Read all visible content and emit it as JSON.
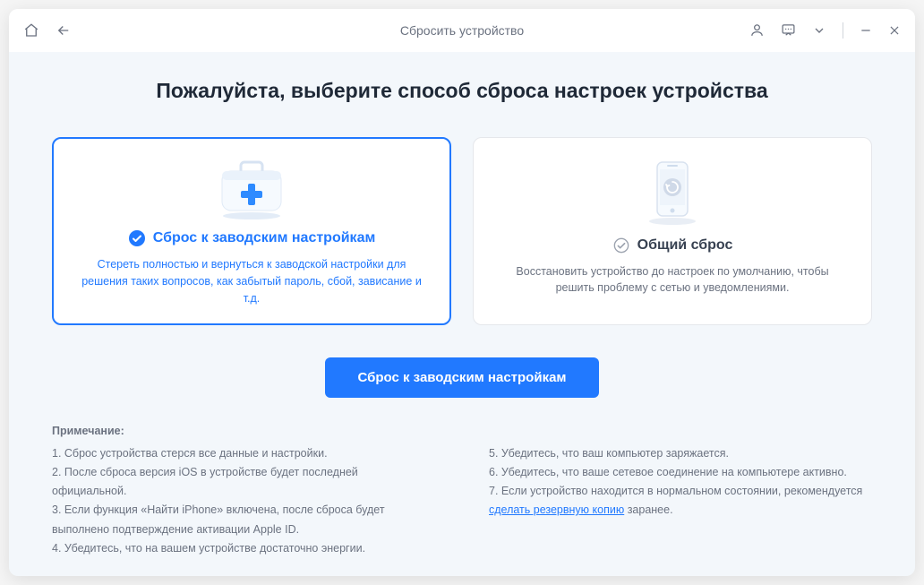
{
  "titlebar": {
    "title": "Сбросить устройство"
  },
  "page": {
    "heading": "Пожалуйста, выберите способ сброса настроек устройства"
  },
  "cards": {
    "factory": {
      "title": "Сброс к заводским настройкам",
      "desc": "Стереть полностью и вернуться к заводской настройки для решения таких вопросов, как забытый пароль, сбой, зависание и т.д."
    },
    "general": {
      "title": "Общий сброс",
      "desc": "Восстановить устройство до настроек по умолчанию, чтобы решить проблему с сетью и уведомлениями."
    }
  },
  "action": {
    "label": "Сброс к заводским настройкам"
  },
  "notes": {
    "label": "Примечание:",
    "left": {
      "n1": "1. Сброс устройства стерся все данные и настройки.",
      "n2": "2. После сброса версия iOS в устройстве будет последней официальной.",
      "n3": "3. Если функция «Найти iPhone» включена, после сброса будет выполнено подтверждение активации Apple ID.",
      "n4": "4. Убедитесь, что на вашем устройстве достаточно энергии."
    },
    "right": {
      "n5": "5. Убедитесь, что ваш компьютер заряжается.",
      "n6": "6. Убедитесь, что ваше сетевое соединение на компьютере активно.",
      "n7_pre": "7. Если устройство находится в нормальном состоянии, рекомендуется ",
      "n7_link": "сделать резервную копию",
      "n7_post": " заранее."
    }
  }
}
